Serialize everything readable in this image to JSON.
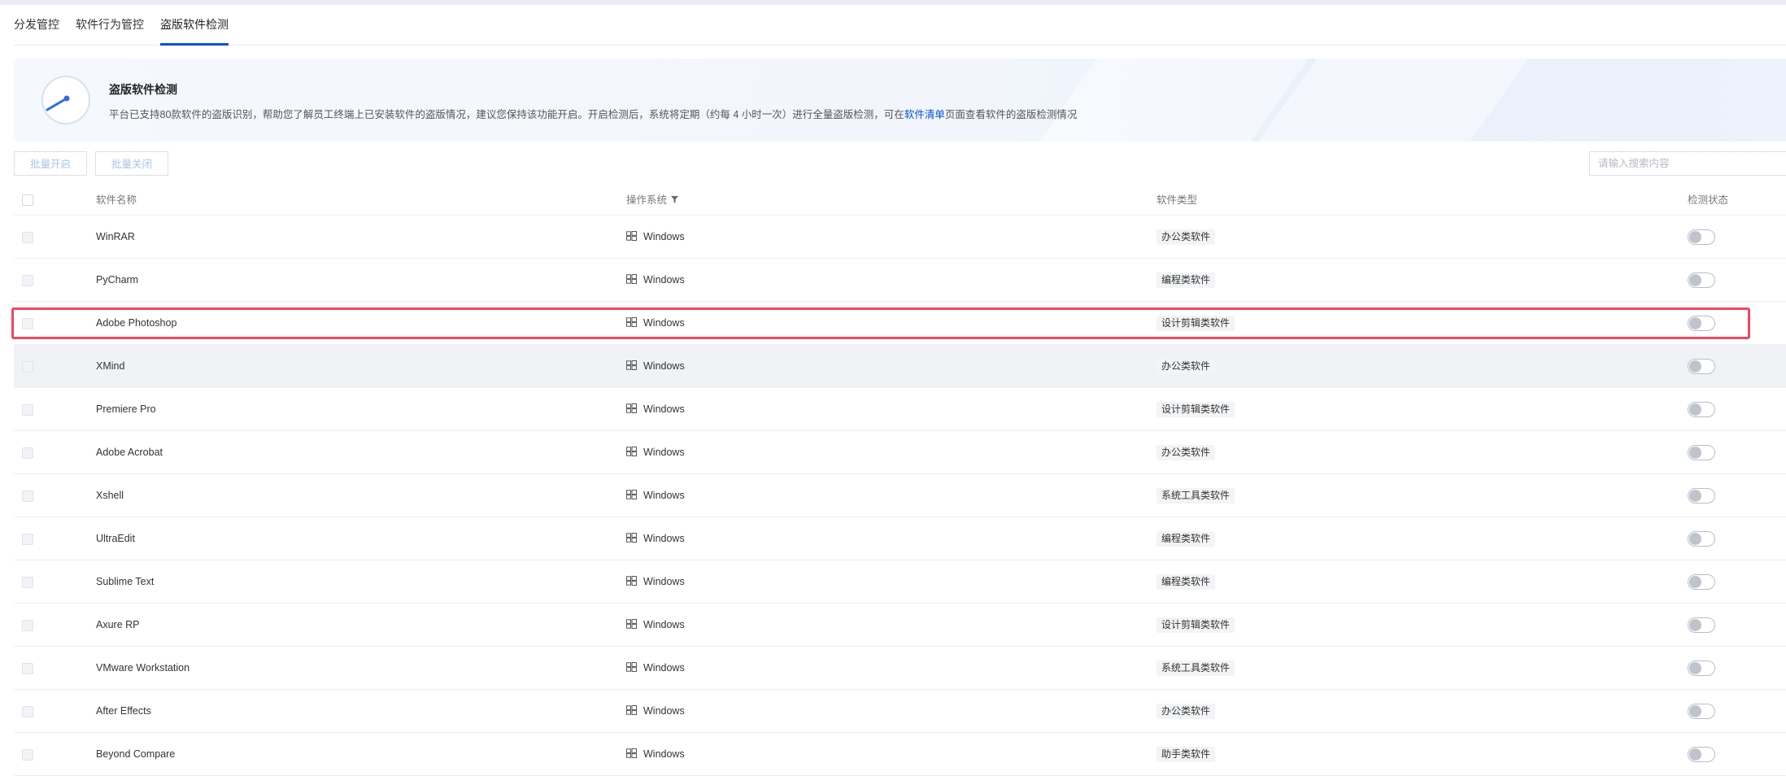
{
  "tabs": [
    {
      "label": "分发管控"
    },
    {
      "label": "软件行为管控"
    },
    {
      "label": "盗版软件检测"
    }
  ],
  "banner": {
    "title": "盗版软件检测",
    "desc_before": "平台已支持80款软件的盗版识别，帮助您了解员工终端上已安装软件的盗版情况，建议您保持该功能开启。开启检测后，系统将定期（约每 4 小时一次）进行全量盗版检测，可在",
    "desc_link": "软件清单",
    "desc_after": "页面查看软件的盗版检测情况"
  },
  "toolbar": {
    "batch_on": "批量开启",
    "batch_off": "批量关闭",
    "search_placeholder": "请输入搜索内容"
  },
  "table": {
    "columns": {
      "name": "软件名称",
      "os": "操作系统",
      "type": "软件类型",
      "status": "检测状态"
    },
    "rows": [
      {
        "name": "WinRAR",
        "os": "Windows",
        "type": "办公类软件",
        "enabled": false
      },
      {
        "name": "PyCharm",
        "os": "Windows",
        "type": "编程类软件",
        "enabled": false
      },
      {
        "name": "Adobe Photoshop",
        "os": "Windows",
        "type": "设计剪辑类软件",
        "enabled": false
      },
      {
        "name": "XMind",
        "os": "Windows",
        "type": "办公类软件",
        "enabled": false
      },
      {
        "name": "Premiere Pro",
        "os": "Windows",
        "type": "设计剪辑类软件",
        "enabled": false
      },
      {
        "name": "Adobe Acrobat",
        "os": "Windows",
        "type": "办公类软件",
        "enabled": false
      },
      {
        "name": "Xshell",
        "os": "Windows",
        "type": "系统工具类软件",
        "enabled": false
      },
      {
        "name": "UltraEdit",
        "os": "Windows",
        "type": "编程类软件",
        "enabled": false
      },
      {
        "name": "Sublime Text",
        "os": "Windows",
        "type": "编程类软件",
        "enabled": false
      },
      {
        "name": "Axure RP",
        "os": "Windows",
        "type": "设计剪辑类软件",
        "enabled": false
      },
      {
        "name": "VMware Workstation",
        "os": "Windows",
        "type": "系统工具类软件",
        "enabled": false
      },
      {
        "name": "After Effects",
        "os": "Windows",
        "type": "办公类软件",
        "enabled": false
      },
      {
        "name": "Beyond Compare",
        "os": "Windows",
        "type": "助手类软件",
        "enabled": false
      }
    ]
  },
  "colors": {
    "accent": "#0052d9",
    "highlight": "#f0485e"
  }
}
